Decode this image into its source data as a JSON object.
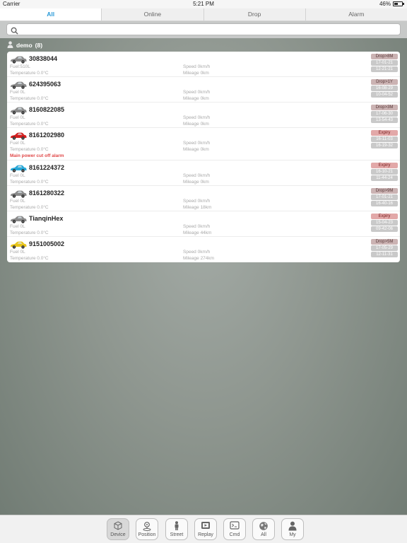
{
  "status_bar": {
    "carrier": "Carrier",
    "time": "5:21 PM",
    "battery": "46%",
    "battery_level": 0.46
  },
  "tabs": [
    {
      "label": "All",
      "active": true
    },
    {
      "label": "Online",
      "active": false
    },
    {
      "label": "Drop",
      "active": false
    },
    {
      "label": "Alarm",
      "active": false
    }
  ],
  "search": {
    "value": "",
    "placeholder": ""
  },
  "group": {
    "name": "demo",
    "count": "(8)"
  },
  "devices": [
    {
      "name": "30838044",
      "car_color": "#8a8a8a",
      "fuel": "Fuel:510L",
      "temperature": "Temperature 0.0°C",
      "speed": "Speed 0km/h",
      "mileage": "Mileage 0km",
      "status": "Drop>8M",
      "date": "17-01-21",
      "time": "12-21-21",
      "alarm": ""
    },
    {
      "name": "624395063",
      "car_color": "#8a8a8a",
      "fuel": "Fuel 0L",
      "temperature": "Temperature 0.0°C",
      "speed": "Speed 0km/h",
      "mileage": "Mileage 0km",
      "status": "Drop>1Y",
      "date": "16-08-29",
      "time": "10-04-52",
      "alarm": ""
    },
    {
      "name": "8160822085",
      "car_color": "#8a8a8a",
      "fuel": "Fuel 0L",
      "temperature": "Temperature 0.0°C",
      "speed": "Speed 0km/h",
      "mileage": "Mileage 0km",
      "status": "Drop>3M",
      "date": "17-06-30",
      "time": "13-54-43",
      "alarm": ""
    },
    {
      "name": "8161202980",
      "car_color": "#d42121",
      "fuel": "Fuel 0L",
      "temperature": "Temperature 0.0°C",
      "speed": "Speed 0km/h",
      "mileage": "Mileage 0km",
      "status": "Expiry",
      "date": "16-11-03",
      "time": "16-19-32",
      "alarm": "Main power cut off alarm"
    },
    {
      "name": "8161224372",
      "car_color": "#28a8d8",
      "fuel": "Fuel 0L",
      "temperature": "Temperature 0.0°C",
      "speed": "Speed 0km/h",
      "mileage": "Mileage 0km",
      "status": "Expiry",
      "date": "16-10-21",
      "time": "11-44-24",
      "alarm": ""
    },
    {
      "name": "8161280322",
      "car_color": "#8a8a8a",
      "fuel": "Fuel 0L",
      "temperature": "Temperature 0.0°C",
      "speed": "Speed 0km/h",
      "mileage": "Mileage 18km",
      "status": "Drop>9M",
      "date": "17-01-21",
      "time": "16-40-16",
      "alarm": ""
    },
    {
      "name": "TianqinHex",
      "car_color": "#8a8a8a",
      "fuel": "Fuel 0L",
      "temperature": "Temperature 0.0°C",
      "speed": "Speed 0km/h",
      "mileage": "Mileage 44km",
      "status": "Expiry",
      "date": "15-04-23",
      "time": "09-42-06",
      "alarm": ""
    },
    {
      "name": "9151005002",
      "car_color": "#e8c51c",
      "fuel": "Fuel 0L",
      "temperature": "Temperature 0.0°C",
      "speed": "Speed 0km/h",
      "mileage": "Mileage 274km",
      "status": "Drop>5M",
      "date": "17-05-29",
      "time": "12-11-31",
      "alarm": ""
    }
  ],
  "toolbar": [
    {
      "label": "Device",
      "icon": "cube-icon",
      "active": true
    },
    {
      "label": "Position",
      "icon": "map-pin-icon",
      "active": false
    },
    {
      "label": "Street",
      "icon": "street-person-icon",
      "active": false
    },
    {
      "label": "Replay",
      "icon": "replay-icon",
      "active": false
    },
    {
      "label": "Cmd",
      "icon": "command-icon",
      "active": false
    },
    {
      "label": "All",
      "icon": "globe-icon",
      "active": false
    },
    {
      "label": "My",
      "icon": "user-icon",
      "active": false
    }
  ]
}
